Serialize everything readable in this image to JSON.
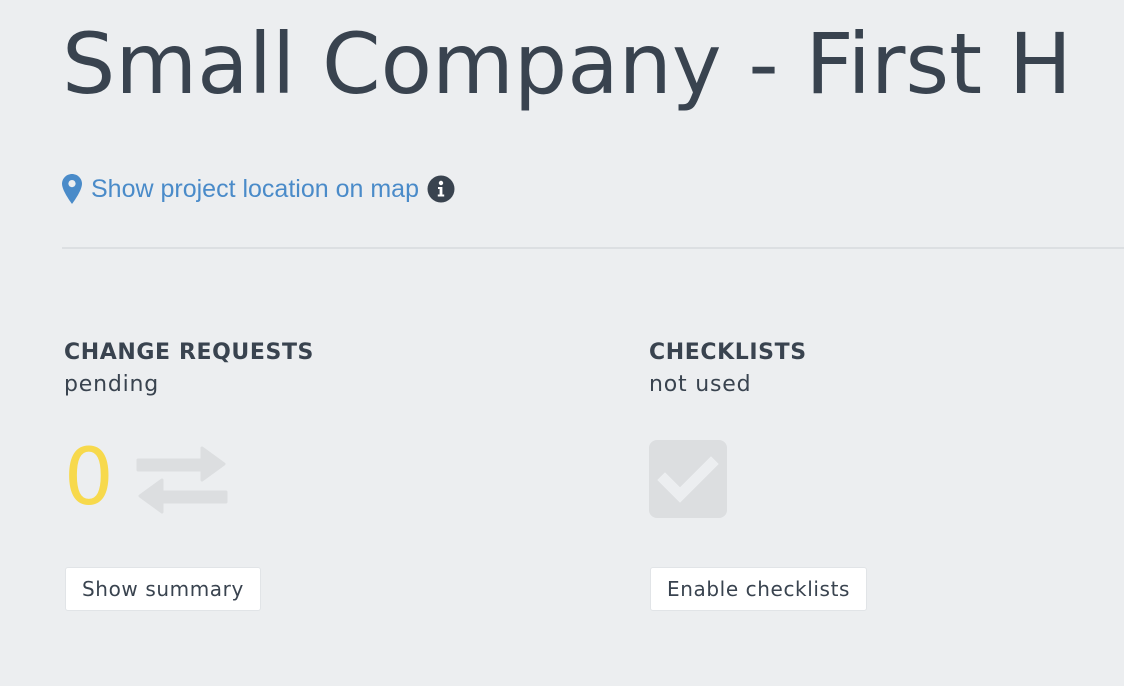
{
  "page": {
    "title": "Small Company - First H"
  },
  "map_link": {
    "label": "Show project location on map",
    "icon": "map-pin-icon",
    "info_icon": "info-circle-icon"
  },
  "change_requests": {
    "heading": "CHANGE REQUESTS",
    "status": "pending",
    "count": "0",
    "icon": "transfer-arrows-icon",
    "button_label": "Show summary"
  },
  "checklists": {
    "heading": "CHECKLISTS",
    "status": "not used",
    "icon": "checkbox-checked-icon",
    "button_label": "Enable checklists"
  },
  "colors": {
    "background": "#eceef0",
    "text": "#39434f",
    "link": "#4a8bc9",
    "count_accent": "#f7d94c",
    "muted_icon": "#dcdee0"
  }
}
